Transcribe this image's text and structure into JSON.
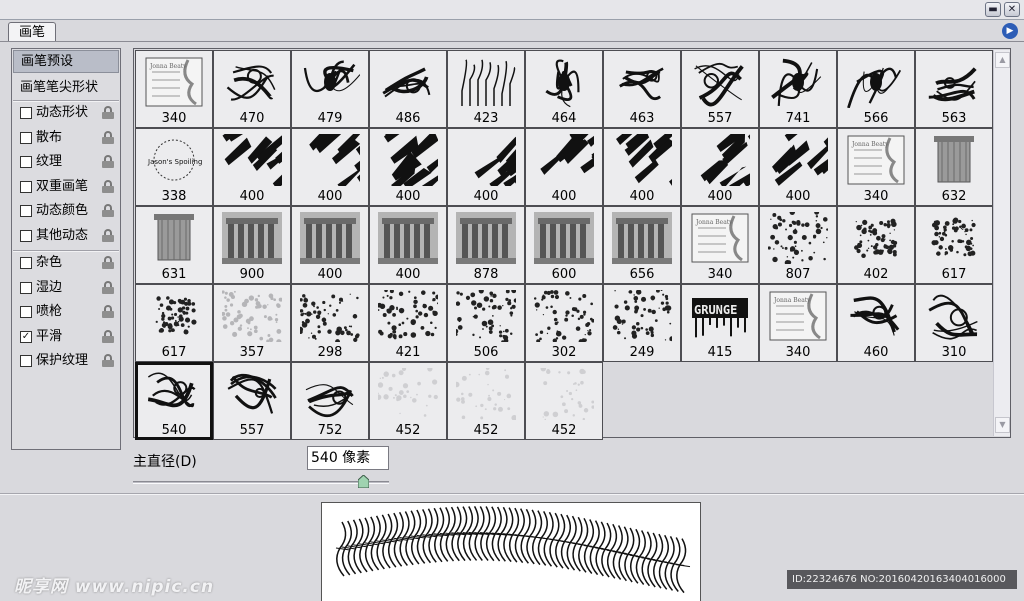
{
  "panel": {
    "tab_label": "画笔",
    "preset_header": "画笔预设",
    "tip_shape_label": "画笔笔尖形状",
    "options_a": [
      {
        "label": "动态形状",
        "checked": false
      },
      {
        "label": "散布",
        "checked": false
      },
      {
        "label": "纹理",
        "checked": false
      },
      {
        "label": "双重画笔",
        "checked": false
      },
      {
        "label": "动态颜色",
        "checked": false
      },
      {
        "label": "其他动态",
        "checked": false
      }
    ],
    "options_b": [
      {
        "label": "杂色",
        "checked": false
      },
      {
        "label": "湿边",
        "checked": false
      },
      {
        "label": "喷枪",
        "checked": false
      },
      {
        "label": "平滑",
        "checked": true
      },
      {
        "label": "保护纹理",
        "checked": false
      }
    ],
    "checkmark": "✓"
  },
  "brushes": [
    {
      "size": "340",
      "kind": "card"
    },
    {
      "size": "470",
      "kind": "swirl"
    },
    {
      "size": "479",
      "kind": "ornament"
    },
    {
      "size": "486",
      "kind": "swirl"
    },
    {
      "size": "423",
      "kind": "drips"
    },
    {
      "size": "464",
      "kind": "ornament"
    },
    {
      "size": "463",
      "kind": "swirl"
    },
    {
      "size": "557",
      "kind": "swirl"
    },
    {
      "size": "741",
      "kind": "ornament"
    },
    {
      "size": "566",
      "kind": "ornament"
    },
    {
      "size": "563",
      "kind": "swirl"
    },
    {
      "size": "338",
      "kind": "text"
    },
    {
      "size": "400",
      "kind": "strokes"
    },
    {
      "size": "400",
      "kind": "strokes"
    },
    {
      "size": "400",
      "kind": "strokes"
    },
    {
      "size": "400",
      "kind": "strokes"
    },
    {
      "size": "400",
      "kind": "strokes"
    },
    {
      "size": "400",
      "kind": "strokes"
    },
    {
      "size": "400",
      "kind": "strokes"
    },
    {
      "size": "400",
      "kind": "strokes"
    },
    {
      "size": "340",
      "kind": "card"
    },
    {
      "size": "632",
      "kind": "column"
    },
    {
      "size": "631",
      "kind": "column"
    },
    {
      "size": "900",
      "kind": "ruins"
    },
    {
      "size": "400",
      "kind": "ruins"
    },
    {
      "size": "400",
      "kind": "ruins"
    },
    {
      "size": "878",
      "kind": "ruins"
    },
    {
      "size": "600",
      "kind": "ruins"
    },
    {
      "size": "656",
      "kind": "ruins"
    },
    {
      "size": "340",
      "kind": "card"
    },
    {
      "size": "807",
      "kind": "grunge"
    },
    {
      "size": "402",
      "kind": "splatter"
    },
    {
      "size": "617",
      "kind": "splatter"
    },
    {
      "size": "617",
      "kind": "splatter"
    },
    {
      "size": "357",
      "kind": "smoke"
    },
    {
      "size": "298",
      "kind": "grunge"
    },
    {
      "size": "421",
      "kind": "grunge"
    },
    {
      "size": "506",
      "kind": "grunge"
    },
    {
      "size": "302",
      "kind": "grunge"
    },
    {
      "size": "249",
      "kind": "grunge"
    },
    {
      "size": "415",
      "kind": "grungetext"
    },
    {
      "size": "340",
      "kind": "card"
    },
    {
      "size": "460",
      "kind": "swirl"
    },
    {
      "size": "310",
      "kind": "swirl"
    },
    {
      "size": "540",
      "kind": "swirl"
    },
    {
      "size": "557",
      "kind": "swirl"
    },
    {
      "size": "752",
      "kind": "swirl"
    },
    {
      "size": "452",
      "kind": "faint"
    },
    {
      "size": "452",
      "kind": "faint"
    },
    {
      "size": "452",
      "kind": "faint"
    }
  ],
  "selected_brush_index": 44,
  "brush_texts": {
    "card": "Jonna Beaty",
    "text": "Jason's Spoiling",
    "grungetext": "GRUNGE"
  },
  "diameter": {
    "label": "主直径(D)",
    "value": "540 像素",
    "slider_fraction": 0.9
  },
  "watermark": {
    "logo": "昵享网 www.nipic.cn",
    "id_text": "ID:22324676 NO:20160420163404016000"
  },
  "icons": {
    "minimize": "minimize-icon",
    "close": "close-icon",
    "panel_menu": "panel-menu-arrow-icon",
    "lock": "lock-icon"
  }
}
